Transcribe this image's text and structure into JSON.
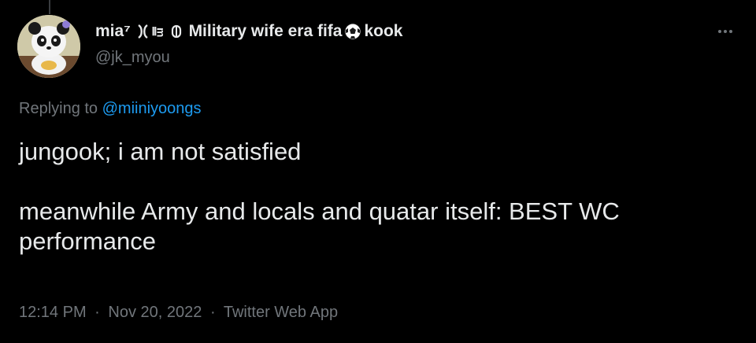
{
  "author": {
    "name_part1": "mia⁷",
    "name_part2": "⦀ᴟ",
    "name_part3": "Military wife era fifa",
    "name_part4": "kook",
    "handle": "@jk_myou"
  },
  "icons": {
    "avatar": "panda-avatar-icon",
    "name_emoji_1": "crescent-symbol-icon",
    "name_emoji_2": "soccer-ball-icon",
    "more": "more-options-icon"
  },
  "reply": {
    "prefix": "Replying to",
    "mention": "@miiniyoongs"
  },
  "tweet": {
    "line1": "jungook; i am not satisfied",
    "line2": "meanwhile Army and locals and quatar itself: BEST WC performance"
  },
  "meta": {
    "time": "12:14 PM",
    "date": "Nov 20, 2022",
    "source": "Twitter Web App",
    "separator": "·"
  },
  "colors": {
    "background": "#000000",
    "text": "#e7e9ea",
    "muted": "#71767b",
    "link": "#1d9bf0"
  }
}
